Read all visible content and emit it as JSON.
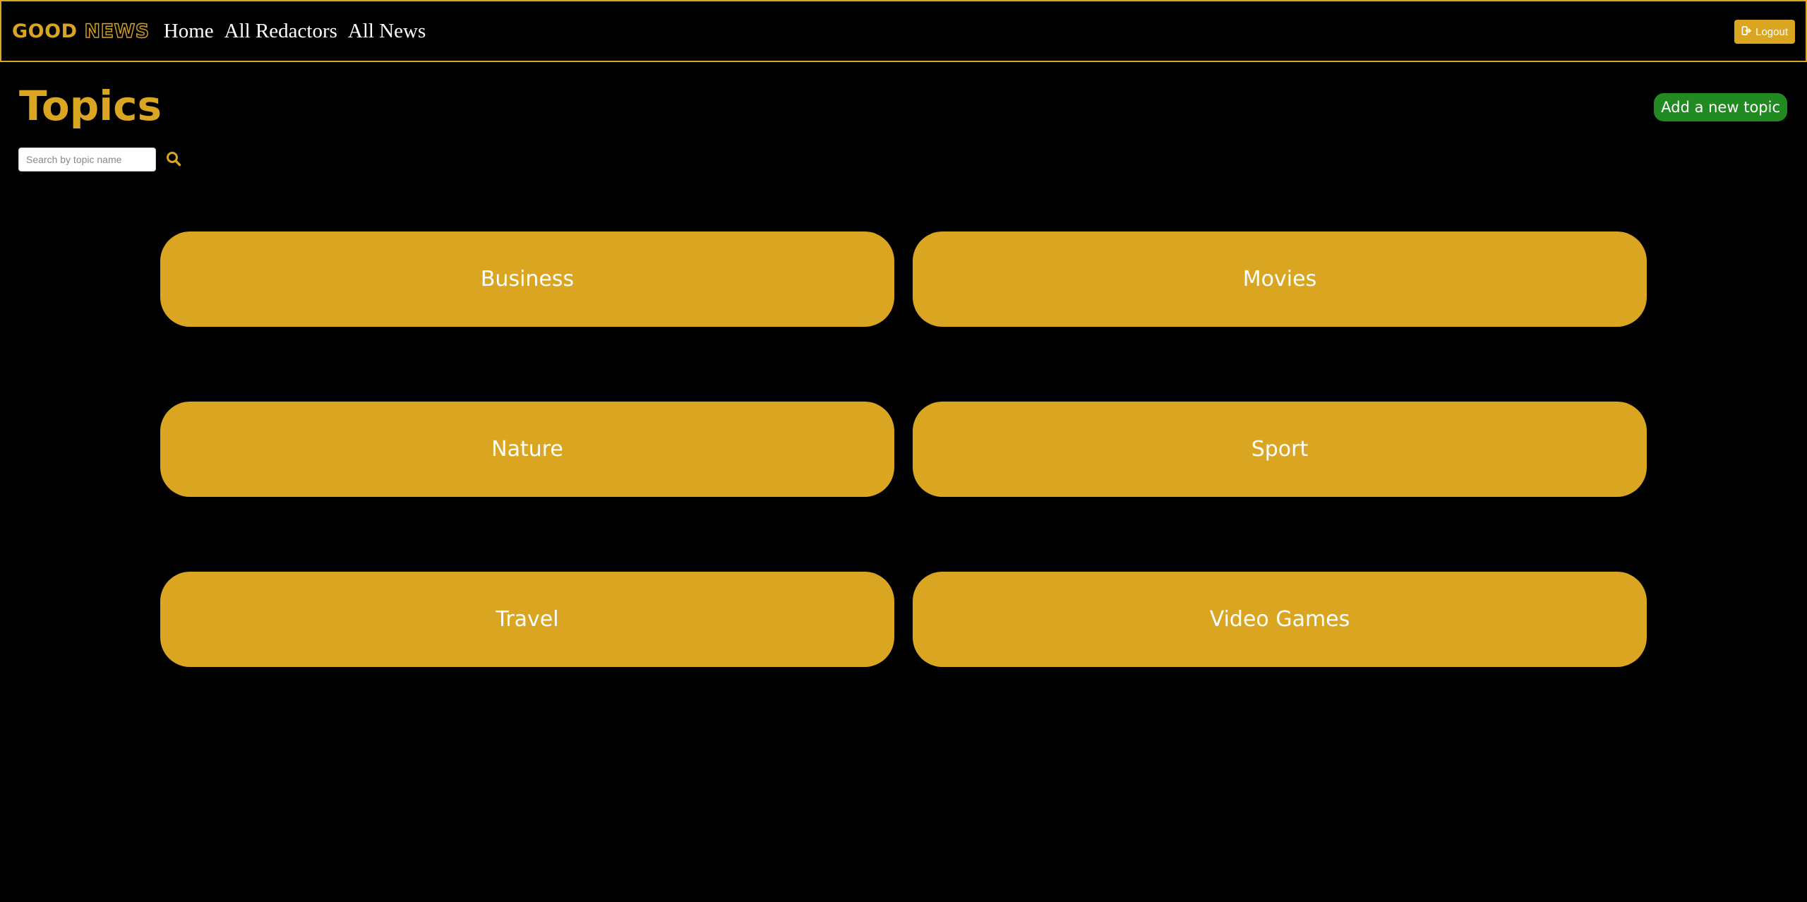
{
  "navbar": {
    "brand_part1": "GOOD",
    "brand_part2": "NEWS",
    "links": [
      {
        "label": "Home"
      },
      {
        "label": "All Redactors"
      },
      {
        "label": "All News"
      }
    ],
    "logout_label": "Logout",
    "logout_icon": "sign-out-icon"
  },
  "page": {
    "title": "Topics",
    "add_button_label": "Add a new topic"
  },
  "search": {
    "placeholder": "Search by topic name",
    "value": "",
    "icon": "search-icon"
  },
  "topics": [
    {
      "name": "Business"
    },
    {
      "name": "Movies"
    },
    {
      "name": "Nature"
    },
    {
      "name": "Sport"
    },
    {
      "name": "Travel"
    },
    {
      "name": "Video Games"
    }
  ],
  "colors": {
    "accent": "#DAA520",
    "background": "#000000",
    "add_button": "#218A21",
    "text": "#FFFFFF"
  }
}
